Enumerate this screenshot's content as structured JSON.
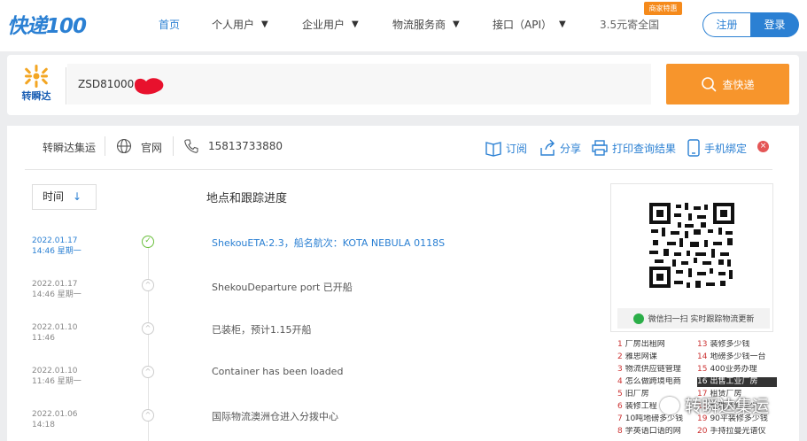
{
  "brand": {
    "logo_text": "快递100"
  },
  "nav": {
    "home": "首页",
    "personal": "个人用户",
    "enterprise": "企业用户",
    "logistics": "物流服务商",
    "api": "接口（API）",
    "promo": "3.5元寄全国",
    "badge": "商家特惠",
    "caret": "▼"
  },
  "auth": {
    "register": "注册",
    "login": "登录"
  },
  "search": {
    "carrier_logo_text": "转瞬达",
    "value": "ZSD81000",
    "button": "查快递",
    "redaction_color": "#e8112d"
  },
  "carrier": {
    "name": "转瞬达集运",
    "website": "官网",
    "phone": "15813733880"
  },
  "actions": {
    "subscribe": "订阅",
    "share": "分享",
    "print": "打印查询结果",
    "bind": "手机绑定",
    "close": "×"
  },
  "timeline": {
    "sort_label": "时间",
    "sort_arrow": "↓",
    "header": "地点和跟踪进度",
    "events": [
      {
        "date": "2022.01.17",
        "time": "14:46 星期一",
        "text": "ShekouETA:2.3，船名航次：KOTA NEBULA 0118S"
      },
      {
        "date": "2022.01.17",
        "time": "14:46 星期一",
        "text": "ShekouDeparture port 已开船"
      },
      {
        "date": "2022.01.10",
        "time": "11:46",
        "text": "已装柜，预计1.15开船"
      },
      {
        "date": "2022.01.10",
        "time": "11:46 星期一",
        "text": "Container has been loaded"
      },
      {
        "date": "2022.01.06",
        "time": "14:18",
        "text": "国际物流澳洲仓进入分拨中心"
      }
    ]
  },
  "sidebar": {
    "wechat_text": "微信扫一扫 实时跟踪物流更新",
    "links": [
      {
        "n": "1",
        "t": "厂房出租网"
      },
      {
        "n": "13",
        "t": "装修多少钱"
      },
      {
        "n": "2",
        "t": "雅思网课"
      },
      {
        "n": "14",
        "t": "地磅多少钱一台"
      },
      {
        "n": "3",
        "t": "物流供应链管理"
      },
      {
        "n": "15",
        "t": "400业务办理"
      },
      {
        "n": "4",
        "t": "怎么做跨境电商"
      },
      {
        "n": "16",
        "t": "出售工业厂房"
      },
      {
        "n": "5",
        "t": "旧厂房"
      },
      {
        "n": "17",
        "t": "租赁厂房"
      },
      {
        "n": "6",
        "t": "装修工程"
      },
      {
        "n": "18",
        "t": "整理装修多少"
      },
      {
        "n": "7",
        "t": "10吨地磅多少钱"
      },
      {
        "n": "19",
        "t": "90平装修多少钱"
      },
      {
        "n": "8",
        "t": "学英语口语的网"
      },
      {
        "n": "20",
        "t": "手持拉曼光谱仪"
      }
    ]
  },
  "watermark": {
    "text": "转瞬达集运"
  },
  "colors": {
    "brand_blue": "#2b80d3",
    "search_orange": "#f7952c",
    "check_green": "#6abf3c"
  }
}
